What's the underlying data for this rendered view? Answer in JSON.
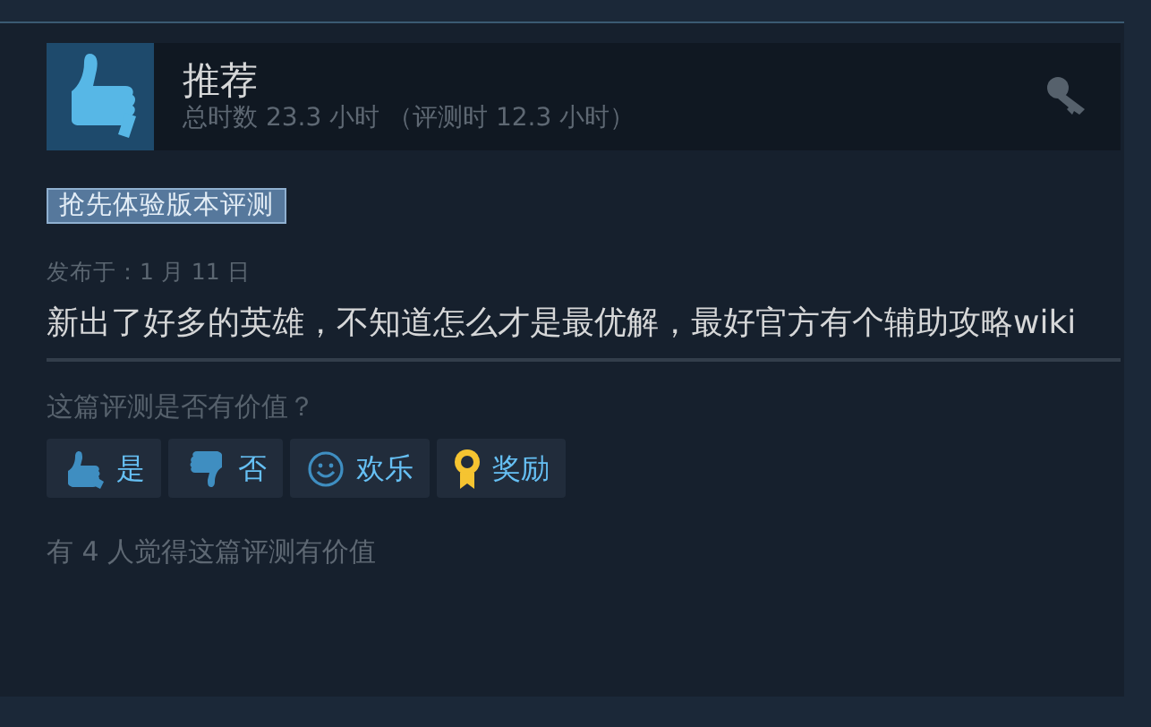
{
  "review": {
    "verdict": "推荐",
    "hours": "总时数 23.3 小时 （评测时 12.3 小时）",
    "tag": "抢先体验版本评测",
    "posted": "发布于：1 月 11 日",
    "text": "新出了好多的英雄，不知道怎么才是最优解，最好官方有个辅助攻略wiki"
  },
  "helpful_prompt": "这篇评测是否有价值？",
  "buttons": [
    {
      "kind": "yes",
      "label": "是"
    },
    {
      "kind": "no",
      "label": "否"
    },
    {
      "kind": "funny",
      "label": "欢乐"
    },
    {
      "kind": "award",
      "label": "奖励"
    }
  ],
  "helpful_count": "有 4 人觉得这篇评测有价值"
}
